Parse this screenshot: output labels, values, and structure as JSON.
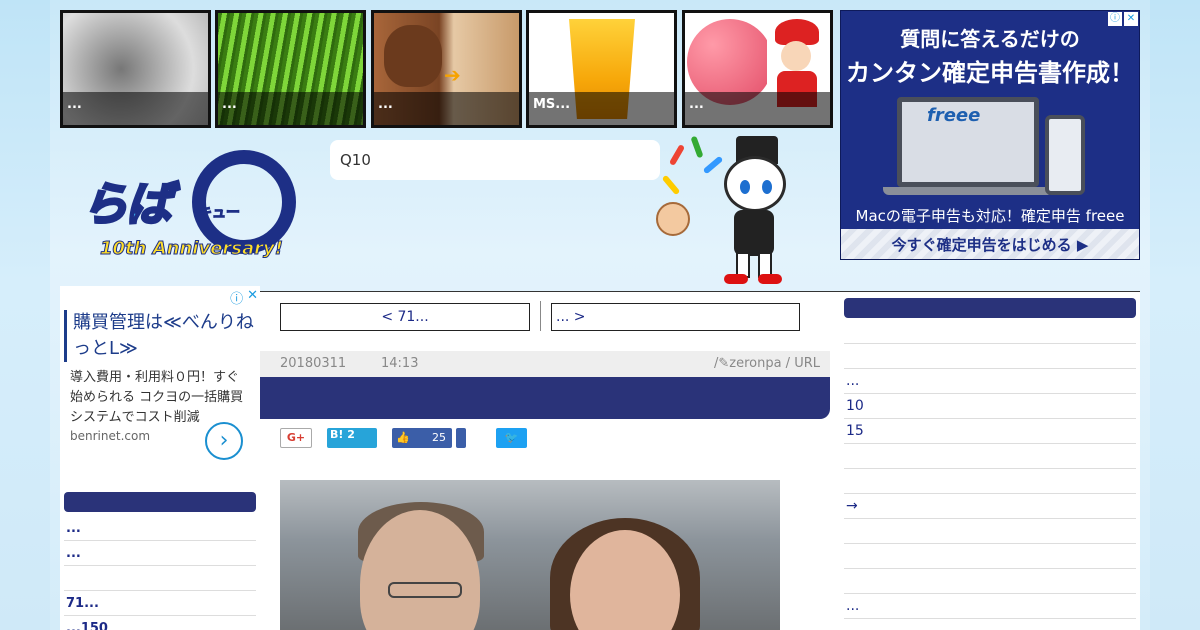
{
  "thumbnails": [
    {
      "caption": "..."
    },
    {
      "caption": "..."
    },
    {
      "caption": "..."
    },
    {
      "caption": "MS..."
    },
    {
      "caption": "..."
    }
  ],
  "search": {
    "value": "Q10"
  },
  "top_ad": {
    "line1": "質問に答えるだけの",
    "line2": "カンタン確定申告書作成！",
    "brand": "freee",
    "line3": "Macの電子申告も対応！確定申告 freee",
    "cta": "今すぐ確定申告をはじめる ▶"
  },
  "left_ad": {
    "title": "購買管理は≪べんりねっとL≫",
    "desc": "導入費用・利用料０円！すぐ始められる コクヨの一括購買システムでコスト削減",
    "domain": "benrinet.com",
    "go": "›"
  },
  "logo": {
    "main": "らば",
    "sub": "キュー",
    "anniv": "10th Anniversary!"
  },
  "left_sidebar": {
    "links": [
      "...",
      "...",
      "",
      "71...",
      "...150"
    ]
  },
  "article": {
    "prev": "< 71...",
    "next": "... >",
    "date": "20180311",
    "time": "14:13",
    "author": "zeronpa",
    "url_label": "URL"
  },
  "share": {
    "google": "G+",
    "hatena": "B! 2",
    "facebook_count": "25"
  },
  "right_sidebar": {
    "links": [
      "",
      "",
      "...",
      "10",
      "15",
      "",
      "",
      "→",
      "",
      "",
      "..."
    ]
  },
  "colors": {
    "navy": "#2a3379",
    "link": "#1c2a87"
  }
}
